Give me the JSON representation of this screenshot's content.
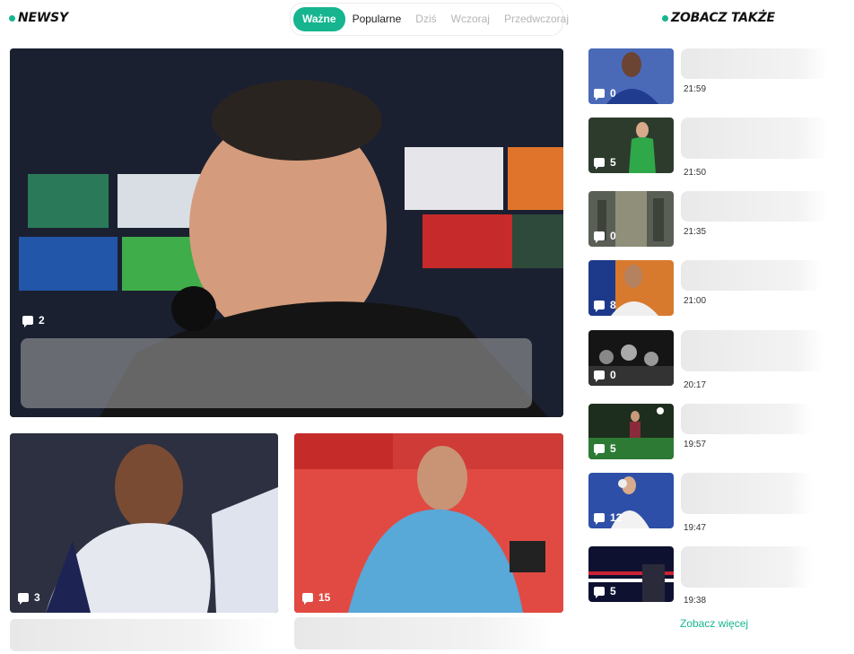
{
  "newsy": {
    "title": "NEWSY"
  },
  "tabs": [
    {
      "label": "Ważne",
      "state": "active"
    },
    {
      "label": "Popularne",
      "state": "normal"
    },
    {
      "label": "Dziś",
      "state": "disabled"
    },
    {
      "label": "Wczoraj",
      "state": "disabled"
    },
    {
      "label": "Przedwczoraj",
      "state": "disabled"
    }
  ],
  "hero": {
    "comments": "2"
  },
  "cards": [
    {
      "comments": "3"
    },
    {
      "comments": "15"
    }
  ],
  "zobacz": {
    "title": "ZOBACZ TAKŻE",
    "items": [
      {
        "comments": "0",
        "time": "21:59"
      },
      {
        "comments": "5",
        "time": "21:50"
      },
      {
        "comments": "0",
        "time": "21:35"
      },
      {
        "comments": "8",
        "time": "21:00"
      },
      {
        "comments": "0",
        "time": "20:17"
      },
      {
        "comments": "5",
        "time": "19:57"
      },
      {
        "comments": "12",
        "time": "19:47"
      },
      {
        "comments": "5",
        "time": "19:38"
      }
    ],
    "more": "Zobacz więcej"
  },
  "colors": {
    "accent": "#16b58f"
  },
  "icons": {
    "comment": "comment-bubble-icon",
    "section": "green-dot-icon"
  }
}
